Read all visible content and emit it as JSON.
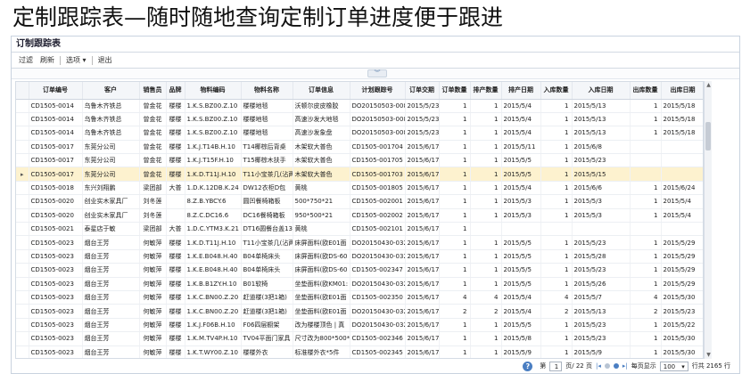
{
  "banner": "定制跟踪表—随时随地查询定制订单进度便于跟进",
  "app": {
    "title": "订制跟踪表",
    "toolbar": {
      "filter": "过滤",
      "refresh": "刷新",
      "options": "选项",
      "options_arrow": "▾",
      "exit": "退出"
    },
    "collapse_glyph": "︾"
  },
  "grid": {
    "columns": [
      "",
      "订单编号",
      "客户",
      "销售员",
      "品牌",
      "物料编码",
      "物料名称",
      "订单信息",
      "计划跟踪号",
      "订单交期",
      "订单数量",
      "排产数量",
      "排产日期",
      "入库数量",
      "入库日期",
      "出库数量",
      "出库日期"
    ],
    "selected_row": 5,
    "selected_marker": "▸",
    "rows": [
      [
        "",
        "CD1505-0014",
        "乌鲁木齐铁总",
        "曾金花",
        "楼楼",
        "1.K.S.BZ00.Z.10",
        "楼楼地毯",
        "沃顿尔皮皮橡胶",
        "DO20150503-008",
        "2015/5/23",
        "1",
        "1",
        "2015/5/4",
        "1",
        "2015/5/13",
        "1",
        "2015/5/18"
      ],
      [
        "",
        "CD1505-0014",
        "乌鲁木齐铁总",
        "曾金花",
        "楼楼",
        "1.K.S.BZ00.Z.10",
        "楼楼地毯",
        "高速沙发大地毯",
        "DO20150503-008",
        "2015/5/23",
        "1",
        "1",
        "2015/5/4",
        "1",
        "2015/5/13",
        "1",
        "2015/5/18"
      ],
      [
        "",
        "CD1505-0014",
        "乌鲁木齐铁总",
        "曾金花",
        "楼楼",
        "1.K.S.BZ00.Z.10",
        "楼楼地毯",
        "高速沙发象盘",
        "DO20150503-008",
        "2015/5/23",
        "1",
        "1",
        "2015/5/4",
        "1",
        "2015/5/13",
        "1",
        "2015/5/18"
      ],
      [
        "",
        "CD1505-0017",
        "东莞分公司",
        "曾金花",
        "楼楼",
        "1.K.J.T14B.H.10",
        "T14椰棕后背桌",
        "木架软大普色",
        "CD1505-001704",
        "2015/6/17",
        "1",
        "1",
        "2015/5/11",
        "1",
        "2015/6/8",
        "",
        ""
      ],
      [
        "",
        "CD1505-0017",
        "东莞分公司",
        "曾金花",
        "楼楼",
        "1.K.J.T15F.H.10",
        "T15椰棕木扶手",
        "木架软大普色",
        "CD1505-001705",
        "2015/6/17",
        "1",
        "1",
        "2015/5/5",
        "1",
        "2015/5/23",
        "",
        ""
      ],
      [
        "",
        "CD1505-0017",
        "东莞分公司",
        "曾金花",
        "楼楼",
        "1.K.D.T11J.H.10",
        "T11小宝茶几(沾两",
        "木架软大普色",
        "CD1505-001703",
        "2015/6/17",
        "1",
        "1",
        "2015/5/5",
        "1",
        "2015/5/15",
        "",
        ""
      ],
      [
        "",
        "CD1505-0018",
        "东兴刘翔鹏",
        "梁团部",
        "大普",
        "1.D.K.12DB.K.24",
        "DW12衣柜D包",
        "黄桃",
        "CD1505-001805",
        "2015/6/17",
        "1",
        "1",
        "2015/5/4",
        "1",
        "2015/6/6",
        "1",
        "2015/6/24"
      ],
      [
        "",
        "CD1505-0020",
        "创业实木家具厂",
        "刘冬莲",
        "",
        "8.Z.B.YBCY.6",
        "圆凹餐椅箱板",
        "500*750*21",
        "CD1505-002001",
        "2015/6/17",
        "1",
        "1",
        "2015/5/3",
        "1",
        "2015/5/3",
        "1",
        "2015/5/4"
      ],
      [
        "",
        "CD1505-0020",
        "创业实木家具厂",
        "刘冬莲",
        "",
        "8.Z.C.DC16.6",
        "DC16餐椅箱板",
        "950*500*21",
        "CD1505-002002",
        "2015/6/17",
        "1",
        "1",
        "2015/5/3",
        "1",
        "2015/5/3",
        "1",
        "2015/5/4"
      ],
      [
        "",
        "CD1505-0021",
        "泰星店于敏",
        "梁团部",
        "大普",
        "1.D.C.YTM3.K.21",
        "DT16圆餐台盖136",
        "黄桃",
        "CD1505-002101",
        "2015/6/17",
        "1",
        "",
        "",
        "",
        "",
        "",
        ""
      ],
      [
        "",
        "CD1505-0023",
        "烟台王芳",
        "何敏萍",
        "楼楼",
        "1.K.D.T11J.H.10",
        "T11小宝茶几(沾两",
        "床屏面料(欧E01面",
        "DO20150430-032",
        "2015/6/17",
        "1",
        "1",
        "2015/5/5",
        "1",
        "2015/5/23",
        "1",
        "2015/5/29"
      ],
      [
        "",
        "CD1505-0023",
        "烟台王芳",
        "何敏萍",
        "楼楼",
        "1.K.E.B048.H.40",
        "B04单椅床头",
        "床屏面料(欧DS-60",
        "DO20150430-032",
        "2015/6/17",
        "1",
        "1",
        "2015/5/5",
        "1",
        "2015/5/28",
        "1",
        "2015/5/29"
      ],
      [
        "",
        "CD1505-0023",
        "烟台王芳",
        "何敏萍",
        "楼楼",
        "1.K.E.B048.H.40",
        "B04单椅床头",
        "床屏面料(欧DS-60",
        "CD1505-002347",
        "2015/6/17",
        "1",
        "1",
        "2015/5/5",
        "1",
        "2015/5/23",
        "1",
        "2015/5/29"
      ],
      [
        "",
        "CD1505-0023",
        "烟台王芳",
        "何敏萍",
        "楼楼",
        "1.K.B.B1ZY.H.10",
        "B01软椅",
        "坐垫面料(欧KM01:",
        "DO20150430-032",
        "2015/6/17",
        "1",
        "1",
        "2015/5/5",
        "1",
        "2015/5/26",
        "1",
        "2015/5/29"
      ],
      [
        "",
        "CD1505-0023",
        "烟台王芳",
        "何敏萍",
        "楼楼",
        "1.K.C.BN00.Z.20",
        "赶道楼(3把1箱)",
        "坐垫面料(欧E01面",
        "CD1505-002350",
        "2015/6/17",
        "4",
        "4",
        "2015/5/4",
        "4",
        "2015/5/7",
        "4",
        "2015/5/30"
      ],
      [
        "",
        "CD1505-0023",
        "烟台王芳",
        "何敏萍",
        "楼楼",
        "1.K.C.BN00.Z.20",
        "赶道楼(3把1箱)",
        "坐垫面料(欧E01面",
        "DO20150430-032",
        "2015/6/17",
        "2",
        "2",
        "2015/5/4",
        "2",
        "2015/5/13",
        "2",
        "2015/5/23"
      ],
      [
        "",
        "CD1505-0023",
        "烟台王芳",
        "何敏萍",
        "楼楼",
        "1.K.J.F06B.H.10",
        "F06四层橱架",
        "改为楼楼顶色 | 真",
        "DO20150430-032",
        "2015/6/17",
        "1",
        "1",
        "2015/5/5",
        "1",
        "2015/5/23",
        "1",
        "2015/5/22"
      ],
      [
        "",
        "CD1505-0023",
        "烟台王芳",
        "何敏萍",
        "楼楼",
        "1.K.M.TV4P.H.10",
        "TV04平面门家具",
        "尺寸改为800*500*",
        "CD1505-002346",
        "2015/6/17",
        "1",
        "1",
        "2015/5/8",
        "1",
        "2015/5/23",
        "1",
        "2015/5/30"
      ],
      [
        "",
        "CD1505-0023",
        "烟台王芳",
        "何敏萍",
        "楼楼",
        "1.K.T.WY00.Z.10",
        "楼楼外衣",
        "标准楼外衣*5件",
        "CD1505-002345",
        "2015/6/17",
        "1",
        "1",
        "2015/5/9",
        "1",
        "2015/5/9",
        "1",
        "2015/5/30"
      ]
    ]
  },
  "pager": {
    "help": "?",
    "page_label_before": "第",
    "current_page": "1",
    "page_label_after": "页/ 22 页",
    "per_page_label": "每页显示",
    "per_page_value": "100",
    "total": "行共 2165 行"
  }
}
